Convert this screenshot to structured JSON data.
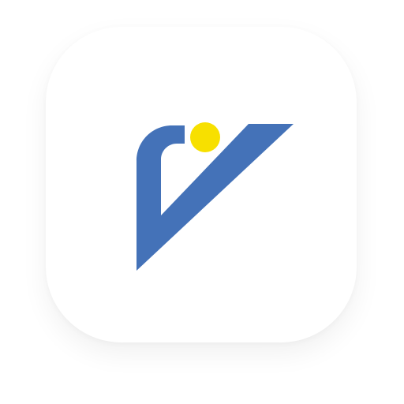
{
  "app_icon": {
    "icon": "v-checkmark-logo-icon",
    "colors": {
      "tile_background": "#ffffff",
      "mark": "#4472b8",
      "dot": "#f7e000"
    }
  }
}
